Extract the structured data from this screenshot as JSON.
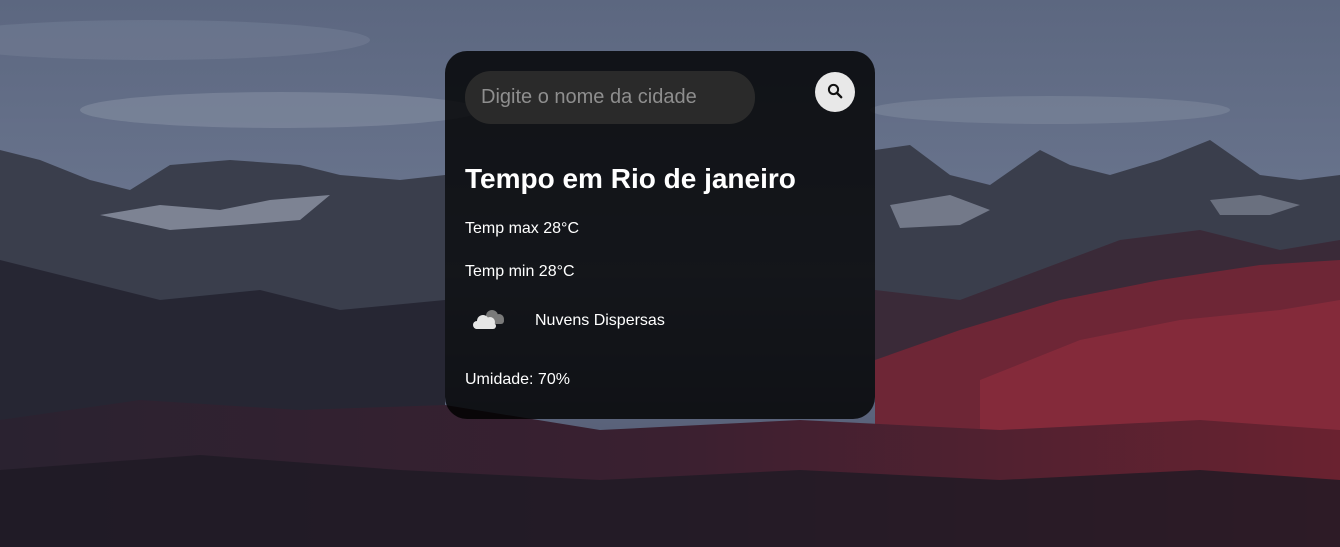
{
  "search": {
    "placeholder": "Digite o nome da cidade",
    "value": "",
    "button_icon": "search-icon"
  },
  "weather": {
    "title": "Tempo em Rio de janeiro",
    "temp_max": "Temp max 28°C",
    "temp_min": "Temp min 28°C",
    "icon": "cloud-icon",
    "description": "Nuvens Dispersas",
    "humidity": "Umidade: 70%"
  },
  "colors": {
    "card_background": "#000000",
    "input_background": "#2a2a2a",
    "button_background": "#e8e8e8",
    "text": "#ffffff"
  }
}
